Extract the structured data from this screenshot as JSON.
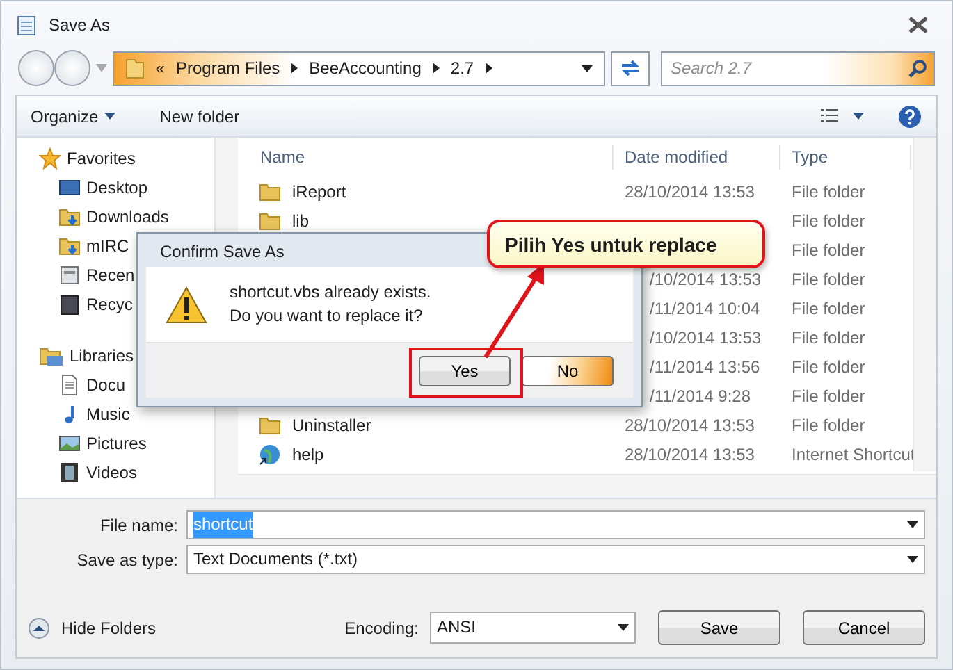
{
  "window": {
    "title": "Save As"
  },
  "address_bar": {
    "crumbs": [
      "«",
      "Program Files",
      "BeeAccounting",
      "2.7"
    ]
  },
  "search": {
    "placeholder": "Search 2.7"
  },
  "toolbar": {
    "organize": "Organize",
    "new_folder": "New folder"
  },
  "sidebar": {
    "groups": [
      {
        "label": "Favorites",
        "kind": "star",
        "children": [
          {
            "label": "Desktop",
            "kind": "desktop"
          },
          {
            "label": "Downloads",
            "kind": "download"
          },
          {
            "label": "mIRC",
            "kind": "download"
          },
          {
            "label": "Recen",
            "kind": "recent"
          },
          {
            "label": "Recyc",
            "kind": "recycle"
          }
        ]
      },
      {
        "label": "Libraries",
        "kind": "library",
        "children": [
          {
            "label": "Docu",
            "kind": "document"
          },
          {
            "label": "Music",
            "kind": "music"
          },
          {
            "label": "Pictures",
            "kind": "pictures"
          },
          {
            "label": "Videos",
            "kind": "videos"
          }
        ]
      }
    ]
  },
  "file_list": {
    "columns": [
      "Name",
      "Date modified",
      "Type"
    ],
    "rows": [
      {
        "kind": "folder",
        "name": "iReport",
        "date": "28/10/2014 13:53",
        "type": "File folder"
      },
      {
        "kind": "folder",
        "name": "lib",
        "type": "File folder"
      },
      {
        "kind": "hidden",
        "type": "File folder"
      },
      {
        "kind": "hidden",
        "date": "/10/2014 13:53",
        "type": "File folder"
      },
      {
        "kind": "hidden",
        "date": "/11/2014 10:04",
        "type": "File folder"
      },
      {
        "kind": "hidden",
        "date": "/10/2014 13:53",
        "type": "File folder"
      },
      {
        "kind": "hidden",
        "date": "/11/2014 13:56",
        "type": "File folder"
      },
      {
        "kind": "hidden",
        "date": "/11/2014 9:28",
        "type": "File folder"
      },
      {
        "kind": "folder",
        "name": "Uninstaller",
        "date": "28/10/2014 13:53",
        "type": "File folder"
      },
      {
        "kind": "shortcut",
        "name": "help",
        "date": "28/10/2014 13:53",
        "type": "Internet Shortcut"
      }
    ]
  },
  "file_name": {
    "label": "File name:",
    "value": "shortcut",
    "text_selected": true
  },
  "save_as_type": {
    "label": "Save as type:",
    "value": "Text Documents (*.txt)"
  },
  "hide_folders": "Hide Folders",
  "encoding": {
    "label": "Encoding:",
    "value": "ANSI"
  },
  "buttons": [
    "Save",
    "Cancel"
  ],
  "confirm_dialog": {
    "title": "Confirm Save As",
    "message": [
      "shortcut.vbs already exists.",
      "Do you want to replace it?"
    ],
    "buttons": [
      {
        "label": "Yes",
        "highlighted": false,
        "annotated": true
      },
      {
        "label": "No",
        "highlighted": true,
        "annotated": false
      }
    ]
  },
  "callout": {
    "text": "Pilih Yes untuk replace"
  }
}
